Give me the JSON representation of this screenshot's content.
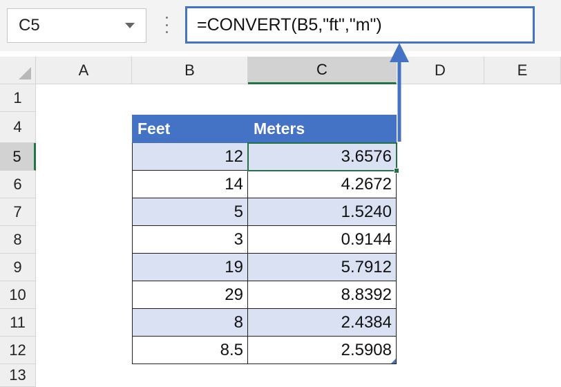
{
  "name_box": {
    "value": "C5"
  },
  "formula_bar": {
    "formula": "=CONVERT(B5,\"ft\",\"m\")"
  },
  "columns": [
    "A",
    "B",
    "C",
    "D",
    "E"
  ],
  "active_column": "C",
  "rows": [
    "1",
    "4",
    "5",
    "6",
    "7",
    "8",
    "9",
    "10",
    "11",
    "12",
    "13"
  ],
  "active_row": "5",
  "table": {
    "headers": [
      "Feet",
      "Meters"
    ],
    "rows": [
      [
        "12",
        "3.6576"
      ],
      [
        "14",
        "4.2672"
      ],
      [
        "5",
        "1.5240"
      ],
      [
        "3",
        "0.9144"
      ],
      [
        "19",
        "5.7912"
      ],
      [
        "29",
        "8.8392"
      ],
      [
        "8",
        "2.4384"
      ],
      [
        "8.5",
        "2.5908"
      ]
    ]
  },
  "colors": {
    "accent": "#4472c4",
    "band": "#d9e1f2",
    "selection": "#217346"
  },
  "icons": {
    "namebox_dropdown": "chevron-down-icon",
    "formula_options": "vertical-dots-icon",
    "annotation": "arrow-up-icon"
  }
}
